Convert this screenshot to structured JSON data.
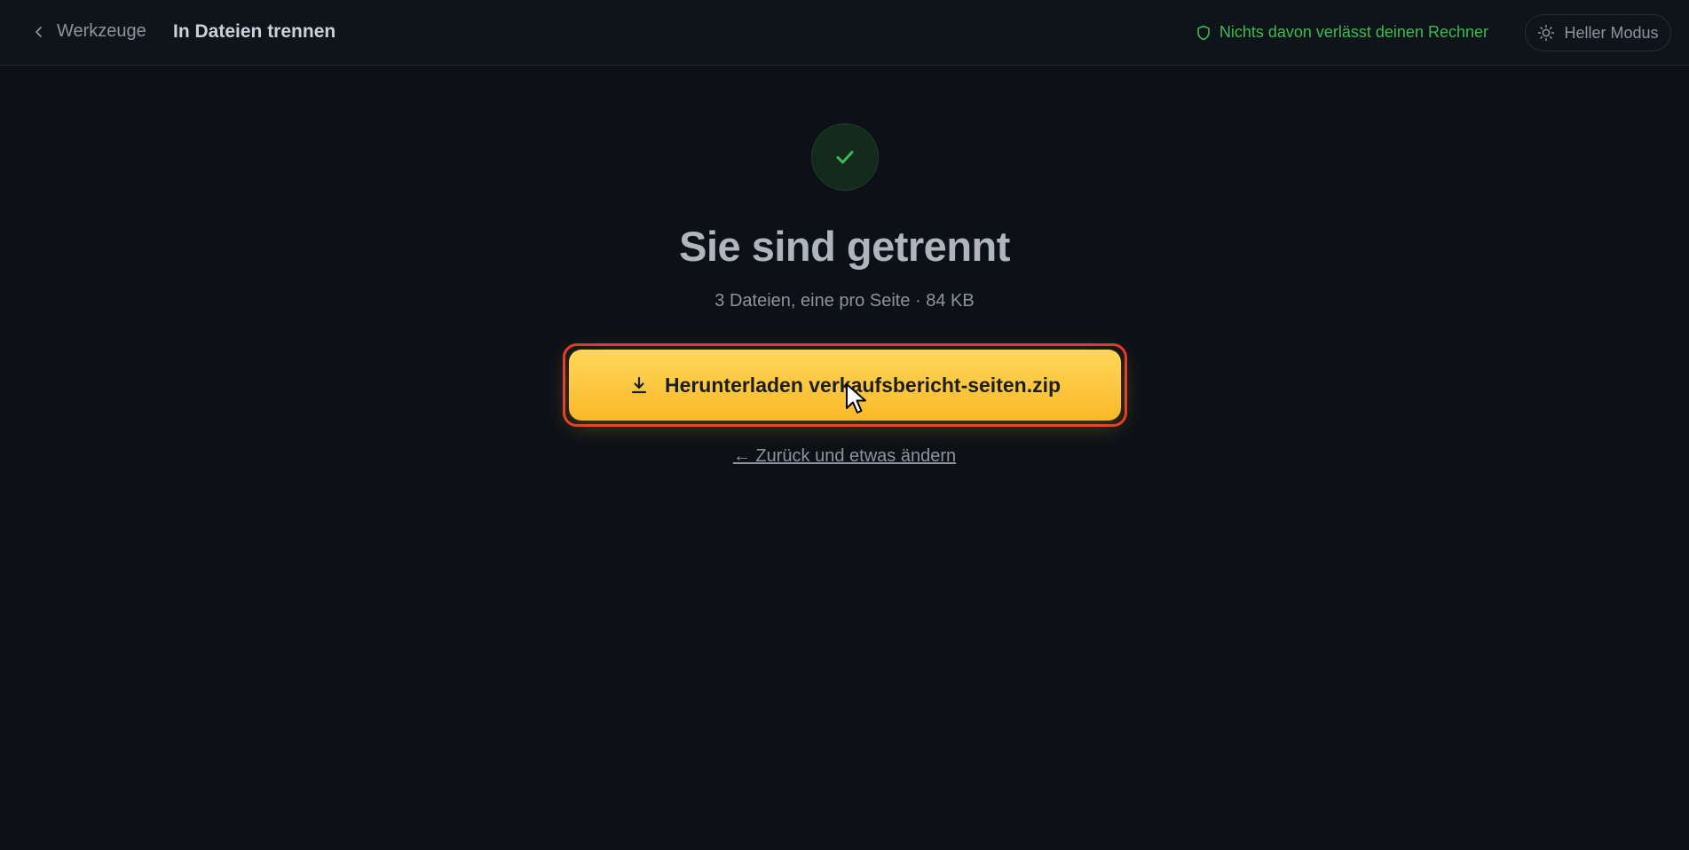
{
  "header": {
    "back_label": "Werkzeuge",
    "title": "In Dateien trennen",
    "privacy_text": "Nichts davon verlässt deinen Rechner",
    "theme_toggle_label": "Heller Modus"
  },
  "result": {
    "headline": "Sie sind getrennt",
    "summary": "3 Dateien, eine pro Seite · 84 KB",
    "download_label": "Herunterladen verkaufsbericht-seiten.zip",
    "back_link": "← Zurück und etwas ändern"
  },
  "icons": {
    "back": "chevron-left-icon",
    "privacy": "shield-icon",
    "theme": "sun-icon",
    "success": "checkmark-icon",
    "download": "download-icon"
  },
  "colors": {
    "background": "#0d1117",
    "accent": "#fbb829",
    "success": "#3fb950",
    "highlight": "#e5372b"
  }
}
